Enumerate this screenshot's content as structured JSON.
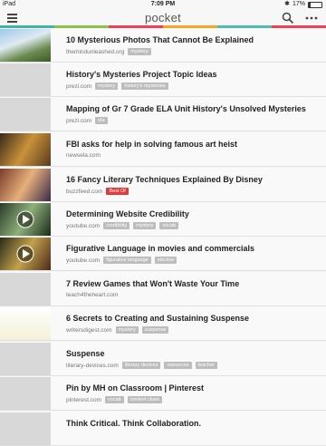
{
  "status": {
    "carrier": "iPad",
    "time": "7:09 PM",
    "battery": "17%"
  },
  "app": {
    "logo": "pocket",
    "accent_colors": [
      "#3fb5a5",
      "#8bc34a",
      "#ef4056",
      "#f5a623",
      "#50bcb6",
      "#ef4056"
    ]
  },
  "icons": {
    "menu": "hamburger-menu-icon",
    "search": "search-icon",
    "more": "more-dots-icon",
    "play": "play-icon"
  },
  "items": [
    {
      "title": "10 Mysterious Photos That Cannot Be Explained",
      "domain": "themindunleashed.org",
      "tags": [
        "mystery"
      ]
    },
    {
      "title": "History's Mysteries Project Topic Ideas",
      "domain": "prezi.com",
      "tags": [
        "mystery",
        "history's mysteries"
      ]
    },
    {
      "title": "Mapping of Gr 7 Grade ELA Unit History's Unsolved Mysteries",
      "domain": "prezi.com",
      "tags": [
        "ela"
      ]
    },
    {
      "title": "FBI asks for help in solving famous art heist",
      "domain": "newsela.com",
      "tags": []
    },
    {
      "title": "16 Fancy Literary Techniques Explained By Disney",
      "domain": "buzzfeed.com",
      "tags": [
        "Best Of"
      ]
    },
    {
      "title": "Determining Website Credibility",
      "domain": "youtube.com",
      "tags": [
        "credibility",
        "mystery",
        "vocab"
      ]
    },
    {
      "title": "Figurative Language in movies and commercials",
      "domain": "youtube.com",
      "tags": [
        "figurative language",
        "elective"
      ]
    },
    {
      "title": "7 Review Games that Won't Waste Your Time",
      "domain": "teach4theheart.com",
      "tags": []
    },
    {
      "title": "6 Secrets to Creating and Sustaining Suspense",
      "domain": "writersdigest.com",
      "tags": [
        "mystery",
        "suspense"
      ]
    },
    {
      "title": "Suspense",
      "domain": "literary-devices.com",
      "tags": [
        "literary devices",
        "resources",
        "teacher"
      ]
    },
    {
      "title": "Pin by MH on Classroom | Pinterest",
      "domain": "pinterest.com",
      "tags": [
        "vocab",
        "context clues"
      ]
    },
    {
      "title": "Think Critical. Think Collaboration.",
      "domain": "",
      "tags": []
    }
  ]
}
